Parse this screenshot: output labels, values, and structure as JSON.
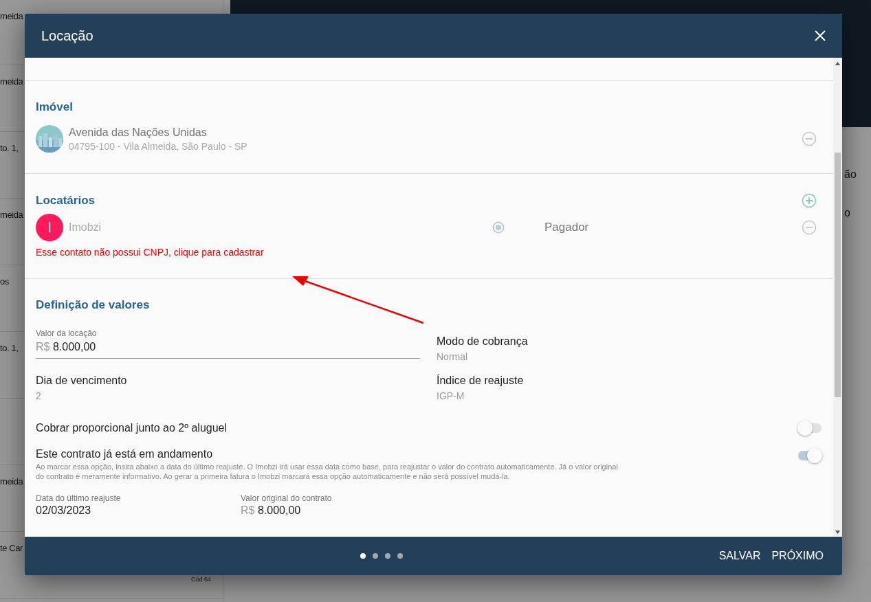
{
  "background": {
    "list_rows": [
      {
        "text": "meida"
      },
      {
        "text": "meida"
      },
      {
        "text": "to. 1,"
      },
      {
        "text": "meida"
      },
      {
        "text": "os"
      },
      {
        "text": "to. 1,"
      },
      {},
      {
        "text": "meida"
      },
      {
        "text": "te Car",
        "badge": "Cód 64"
      }
    ],
    "detail_texts": [
      "ão",
      "o"
    ]
  },
  "modal": {
    "title": "Locação",
    "property": {
      "heading": "Imóvel",
      "name": "Avenida das Nações Unidas",
      "address": "04795-100 - Vila Almeida, São Paulo - SP"
    },
    "tenants": {
      "heading": "Locatários",
      "items": [
        {
          "initial": "I",
          "name": "Imobzi",
          "color": "#ff1a5e",
          "selected": true,
          "role": "Pagador",
          "warning": "Esse contato não possui CNPJ, clique para cadastrar"
        }
      ]
    },
    "values": {
      "heading": "Definição de valores",
      "rent": {
        "label": "Valor da locação",
        "prefix": "R$",
        "value": "8.000,00"
      },
      "fields": [
        {
          "label": "Modo de cobrança",
          "value": "Normal"
        },
        {
          "label": "Dia de vencimento",
          "value": "2"
        },
        {
          "label": "Índice de reajuste",
          "value": "IGP-M"
        }
      ],
      "toggles": [
        {
          "label": "Cobrar proporcional junto ao 2º aluguel",
          "on": false
        },
        {
          "label": "Este contrato já está em andamento",
          "on": true,
          "description": "Ao marcar essa opção, insira abaixo a data do último reajuste. O Imobzi irá usar essa data como base, para reajustar o valor do contrato automaticamente. Já o valor original do contrato é meramente informativo. Ao gerar a primeira fatura o Imobzi marcará essa opção automaticamente e não será possível mudá-la."
        }
      ],
      "last_adjustment": {
        "label": "Data do último reajuste",
        "value": "02/03/2023"
      },
      "original_value": {
        "label": "Valor original do contrato",
        "prefix": "R$",
        "value": "8.000,00"
      }
    },
    "steps": [
      {
        "selected": true
      },
      {
        "selected": false
      },
      {
        "selected": false
      },
      {
        "selected": false
      }
    ],
    "buttons": [
      "SALVAR",
      "PRÓXIMO"
    ]
  }
}
